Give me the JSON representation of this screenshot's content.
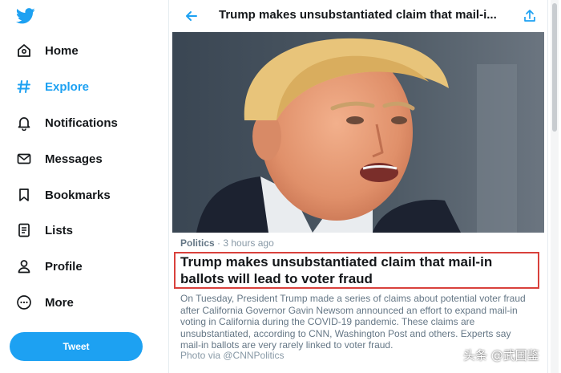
{
  "sidebar": {
    "items": [
      {
        "label": "Home",
        "icon": "home-icon"
      },
      {
        "label": "Explore",
        "icon": "hashtag-icon"
      },
      {
        "label": "Notifications",
        "icon": "bell-icon"
      },
      {
        "label": "Messages",
        "icon": "envelope-icon"
      },
      {
        "label": "Bookmarks",
        "icon": "bookmark-icon"
      },
      {
        "label": "Lists",
        "icon": "list-icon"
      },
      {
        "label": "Profile",
        "icon": "person-icon"
      },
      {
        "label": "More",
        "icon": "more-circle-icon"
      }
    ],
    "active": "Explore",
    "tweet_label": "Tweet"
  },
  "header": {
    "title": "Trump makes unsubstantiated claim that mail-i..."
  },
  "article": {
    "category": "Politics",
    "separator": " · ",
    "time": "3 hours ago",
    "headline": "Trump makes unsubstantiated claim that mail-in ballots will lead to voter fraud",
    "description": "On Tuesday, President Trump made a series of claims about potential voter fraud after California Governor Gavin Newsom announced an effort to expand mail-in voting in California during the COVID-19 pandemic. These claims are unsubstantiated, according to CNN, Washington Post and others. Experts say mail-in ballots are very rarely linked to voter fraud.",
    "credit": "Photo via @CNNPolitics"
  },
  "watermark": "头条 @武国鉴",
  "colors": {
    "accent": "#1da1f2",
    "highlight_border": "#d9413c",
    "text": "#14171a",
    "secondary_text": "#657786"
  }
}
